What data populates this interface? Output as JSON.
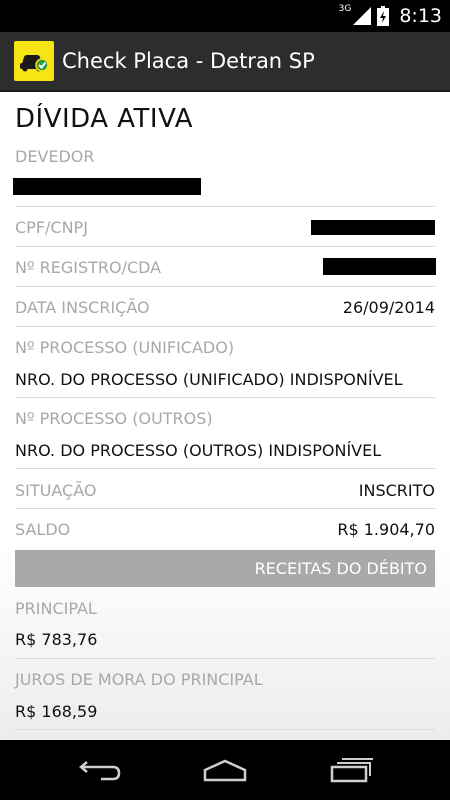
{
  "status_bar": {
    "network": "3G",
    "time": "8:13"
  },
  "app": {
    "title": "Check Placa - Detran SP"
  },
  "page": {
    "title": "DÍVIDA ATIVA"
  },
  "fields": {
    "devedor": {
      "label": "DEVEDOR",
      "value": ""
    },
    "cpf": {
      "label": "CPF/CNPJ",
      "value": ""
    },
    "registro": {
      "label": "Nº REGISTRO/CDA",
      "value": ""
    },
    "data_inscricao": {
      "label": "DATA INSCRIÇÃO",
      "value": "26/09/2014"
    },
    "processo_unificado": {
      "label": "Nº PROCESSO (UNIFICADO)",
      "value": "NRO. DO PROCESSO (UNIFICADO) INDISPONÍVEL"
    },
    "processo_outros": {
      "label": "Nº PROCESSO (OUTROS)",
      "value": "NRO. DO PROCESSO (OUTROS) INDISPONÍVEL"
    },
    "situacao": {
      "label": "SITUAÇÃO",
      "value": "INSCRITO"
    },
    "saldo": {
      "label": "SALDO",
      "value": "R$ 1.904,70"
    }
  },
  "section": {
    "title": "RECEITAS DO DÉBITO"
  },
  "receitas": [
    {
      "label": "PRINCIPAL",
      "value": "R$ 783,76"
    },
    {
      "label": "JUROS DE MORA DO PRINCIPAL",
      "value": "R$ 168,59"
    }
  ],
  "icons": {
    "signal": "signal-icon",
    "battery": "battery-charging-icon",
    "app": "car-check-icon",
    "back": "back-icon",
    "home": "home-icon",
    "recents": "recent-apps-icon"
  }
}
